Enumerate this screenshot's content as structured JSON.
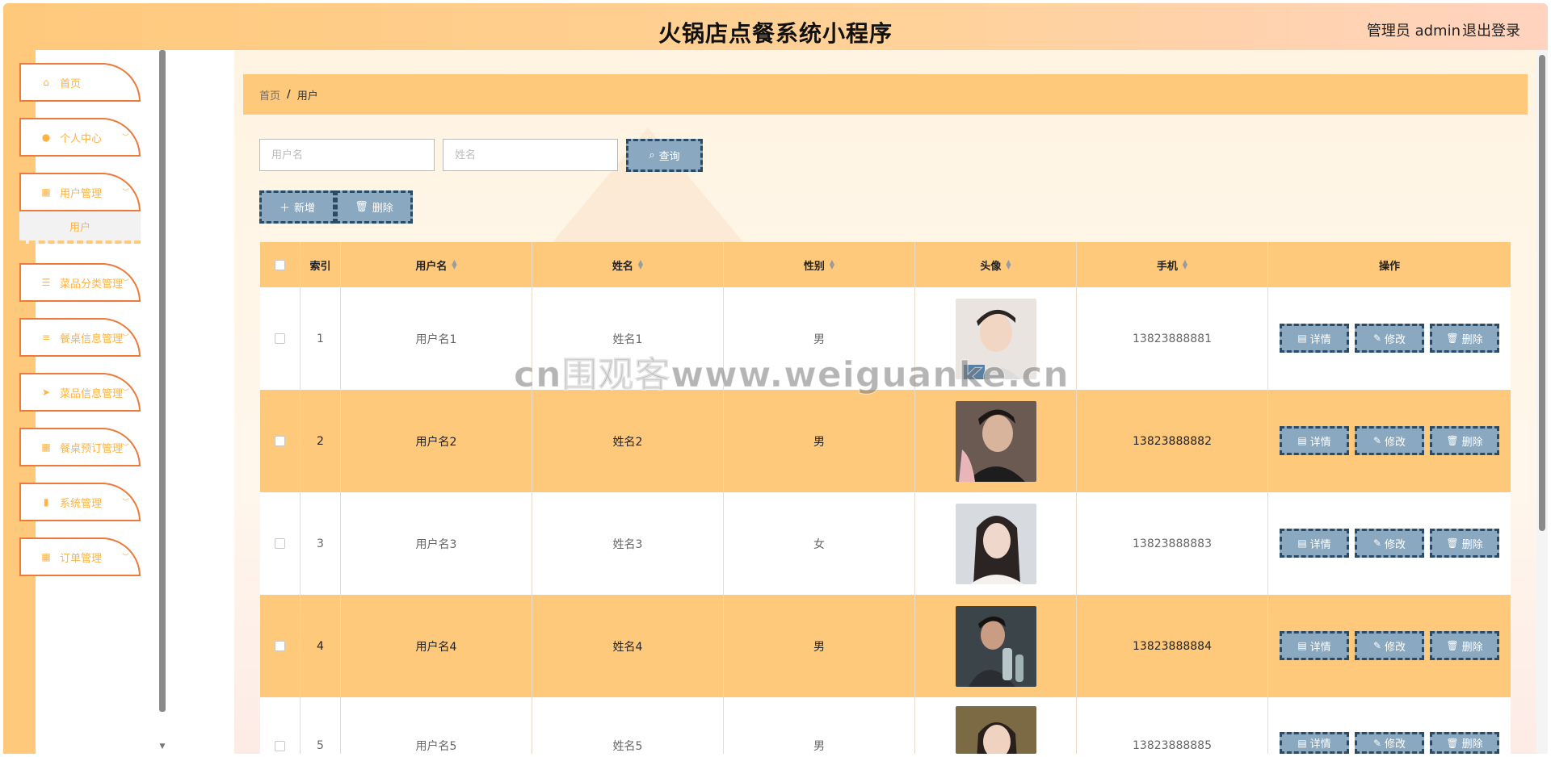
{
  "header": {
    "title": "火锅店点餐系统小程序",
    "user": "管理员 admin",
    "logout": "退出登录"
  },
  "sidebar": {
    "items": [
      {
        "label": "首页",
        "icon": "home-icon",
        "has_children": false
      },
      {
        "label": "个人中心",
        "icon": "user-icon",
        "has_children": true
      },
      {
        "label": "用户管理",
        "icon": "grid-icon",
        "has_children": true
      },
      {
        "label": "菜品分类管理",
        "icon": "sliders-icon",
        "has_children": true
      },
      {
        "label": "餐桌信息管理",
        "icon": "list-icon",
        "has_children": true
      },
      {
        "label": "菜品信息管理",
        "icon": "send-icon",
        "has_children": true
      },
      {
        "label": "餐桌预订管理",
        "icon": "grid-icon",
        "has_children": true
      },
      {
        "label": "系统管理",
        "icon": "clipboard-icon",
        "has_children": true
      },
      {
        "label": "订单管理",
        "icon": "grid-icon",
        "has_children": true
      }
    ],
    "sub_item": "用户"
  },
  "breadcrumb": {
    "home": "首页",
    "separator": "/",
    "current": "用户"
  },
  "search": {
    "username_placeholder": "用户名",
    "name_placeholder": "姓名",
    "query_label": "查询"
  },
  "toolbar": {
    "add_label": "新增",
    "delete_label": "删除"
  },
  "table": {
    "columns": [
      "索引",
      "用户名",
      "姓名",
      "性别",
      "头像",
      "手机",
      "操作"
    ],
    "rows": [
      {
        "index": "1",
        "username": "用户名1",
        "name": "姓名1",
        "gender": "男",
        "phone": "13823888881"
      },
      {
        "index": "2",
        "username": "用户名2",
        "name": "姓名2",
        "gender": "男",
        "phone": "13823888882"
      },
      {
        "index": "3",
        "username": "用户名3",
        "name": "姓名3",
        "gender": "女",
        "phone": "13823888883"
      },
      {
        "index": "4",
        "username": "用户名4",
        "name": "姓名4",
        "gender": "男",
        "phone": "13823888884"
      },
      {
        "index": "5",
        "username": "用户名5",
        "name": "姓名5",
        "gender": "男",
        "phone": "13823888885"
      }
    ],
    "actions": {
      "detail": "详情",
      "edit": "修改",
      "delete": "删除"
    }
  },
  "watermark": "cn围观客www.weiguanke.cn",
  "colors": {
    "accent": "#ffc97c",
    "menu_border": "#ee7a3a",
    "button": "#8aa8bf",
    "button_border": "#2b4a66"
  }
}
